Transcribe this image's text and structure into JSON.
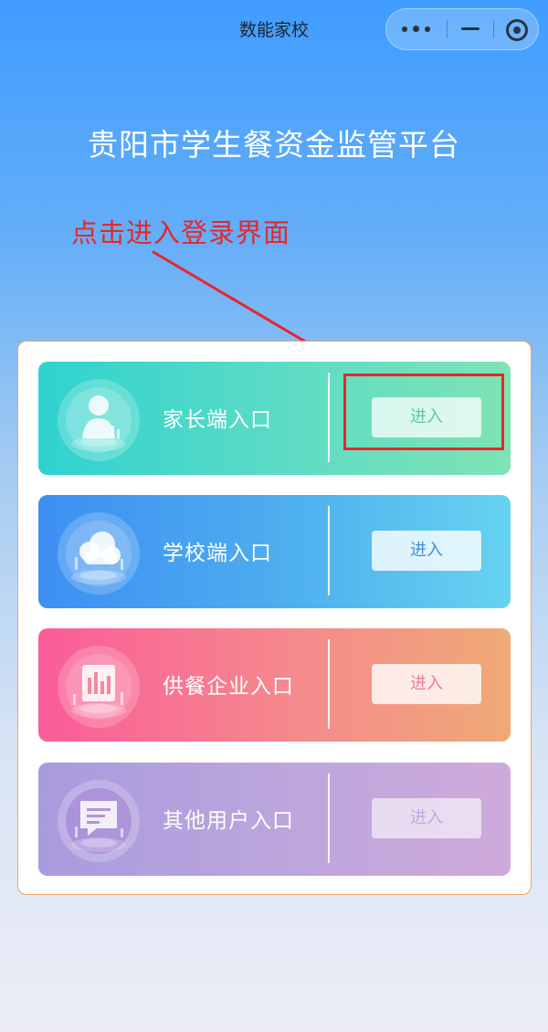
{
  "app": {
    "title": "数能家校"
  },
  "header": {
    "title": "贵阳市学生餐资金监管平台"
  },
  "annotation": {
    "text": "点击进入登录界面",
    "color": "#e8262a"
  },
  "entries": [
    {
      "label": "家长端入口",
      "button": "进入",
      "icon": "parent-avatar-icon",
      "color": "#2fd2d0"
    },
    {
      "label": "学校端入口",
      "button": "进入",
      "icon": "school-cloud-icon",
      "color": "#3d8ff2"
    },
    {
      "label": "供餐企业入口",
      "button": "进入",
      "icon": "supplier-chart-icon",
      "color": "#fb5c99"
    },
    {
      "label": "其他用户入口",
      "button": "进入",
      "icon": "other-user-message-icon",
      "color": "#a99bdf"
    }
  ],
  "capsule": {
    "icons": [
      "more-icon",
      "minimize-icon",
      "close-target-icon"
    ]
  }
}
